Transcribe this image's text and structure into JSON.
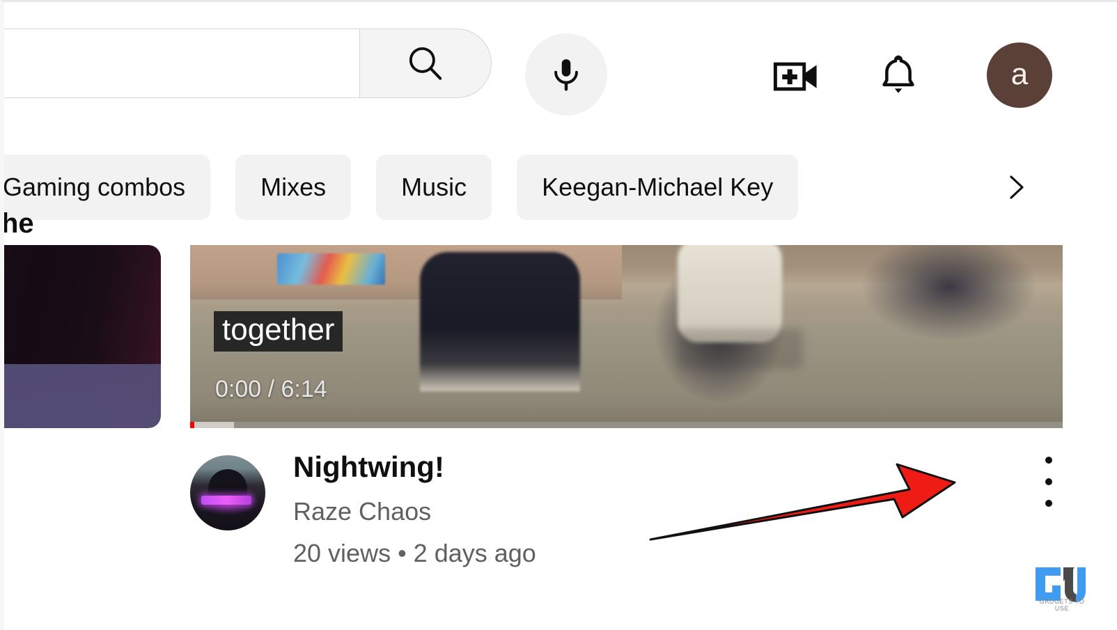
{
  "header": {
    "search": {
      "value": "",
      "placeholder": "",
      "search_button_name": "Search",
      "icon": "search-icon"
    },
    "mic": {
      "label": "Search with your voice",
      "icon": "microphone-icon"
    },
    "create": {
      "label": "Create",
      "icon": "video-camera-plus-icon"
    },
    "notifications": {
      "label": "Notifications",
      "icon": "bell-icon"
    },
    "account": {
      "label": "Account",
      "avatar_letter": "a",
      "avatar_color": "#5b4037"
    }
  },
  "chips": {
    "items": [
      {
        "label": "Gaming combos",
        "selected": false
      },
      {
        "label": "Mixes",
        "selected": false
      },
      {
        "label": "Music",
        "selected": false
      },
      {
        "label": "Keegan-Michael Key",
        "selected": false
      }
    ],
    "next_icon": "chevron-right-icon"
  },
  "grid": {
    "left_card": {
      "title_fragment": "he"
    },
    "main_card": {
      "thumbnail": {
        "caption": "together",
        "time_display": "0:00 / 6:14",
        "current_time": "0:00",
        "duration": "6:14",
        "progress_percent": 0,
        "progress_color": "#ff0000"
      },
      "title": "Nightwing!",
      "channel": "Raze Chaos",
      "stats": "20 views • 2 days ago",
      "views": "20 views",
      "published": "2 days ago",
      "more_menu": {
        "label": "More actions",
        "icon": "three-dot-vertical-icon"
      }
    }
  },
  "annotation": {
    "arrow": {
      "color": "#ee1c14",
      "direction": "right",
      "points_to": "more-menu-button"
    }
  },
  "watermark": {
    "logo_text": "GU",
    "caption": "GADGETS TO USE",
    "color": "#3f9cf0"
  }
}
